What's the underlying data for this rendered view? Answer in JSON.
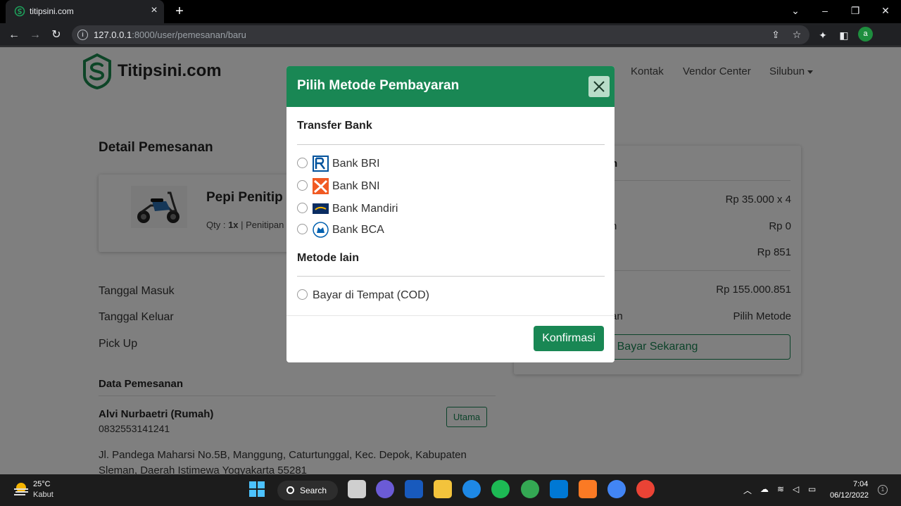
{
  "browser": {
    "tab_title": "titipsini.com",
    "tab_close": "×",
    "new_tab": "+",
    "url_host": "127.0.0.1",
    "url_rest": ":8000/user/pemesanan/baru",
    "profile_initial": "a"
  },
  "navbar": {
    "brand": "Titipsini.com",
    "links": [
      "Kontak",
      "Vendor Center"
    ],
    "user": "Silubun"
  },
  "detail": {
    "heading": "Detail Pemesanan",
    "product_name": "Pepi Penitip",
    "qty_prefix": "Qty : ",
    "qty_value": "1x",
    "qty_suffix": " | Penitipan",
    "rows": [
      "Tanggal Masuk",
      "Tanggal Keluar",
      "Pick Up"
    ]
  },
  "data_pemesanan": {
    "heading": "Data Pemesanan",
    "name": "Alvi Nurbaetri (Rumah)",
    "phone": "0832553141241",
    "badge": "Utama",
    "address_line1": "Jl. Pandega Maharsi No.5B, Manggung, Caturtunggal, Kec. Depok, Kabupaten",
    "address_line2": "Sleman, Daerah Istimewa Yogyakarta 55281"
  },
  "summary": {
    "title_fragment": "n",
    "price": "Rp 35.000 x 4",
    "label2_fragment": "n",
    "discount": "Rp 0",
    "fee": "Rp 851",
    "total": "Rp 155.000.851",
    "method_label_fragment": "an",
    "method_value": "Pilih Metode",
    "pay_button": "Bayar Sekarang"
  },
  "modal": {
    "title": "Pilih Metode Pembayaran",
    "section_bank": "Transfer Bank",
    "banks": [
      "Bank BRI",
      "Bank BNI",
      "Bank Mandiri",
      "Bank BCA"
    ],
    "section_other": "Metode lain",
    "other_methods": [
      "Bayar di Tempat (COD)"
    ],
    "confirm_button": "Konfirmasi"
  },
  "taskbar": {
    "temperature": "25°C",
    "weather": "Kabut",
    "search": "Search",
    "time": "7:04",
    "date": "06/12/2022"
  },
  "colors": {
    "brand_green": "#198754",
    "overlay": "rgba(0,0,0,0.5)"
  }
}
